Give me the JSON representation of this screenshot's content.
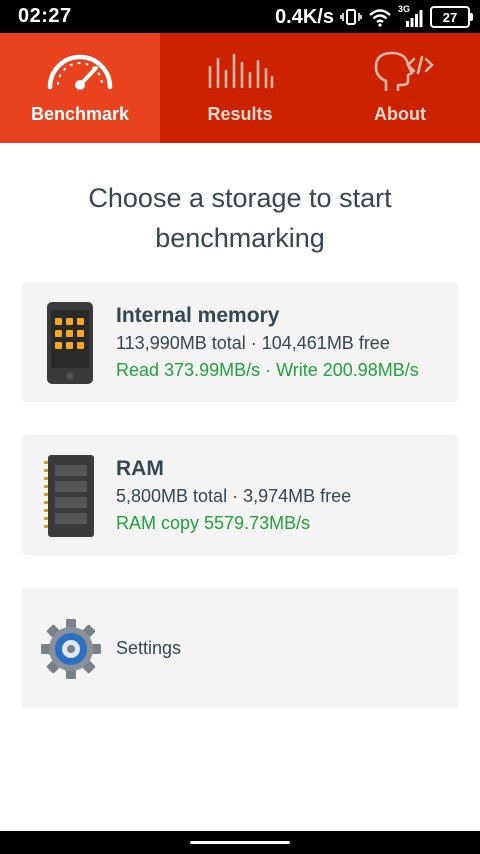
{
  "status_bar": {
    "time": "02:27",
    "net_speed": "0.4K/s",
    "network_type": "3G",
    "battery": "27",
    "icons": [
      "vibrate-icon",
      "wifi-icon",
      "signal-icon",
      "battery-icon"
    ]
  },
  "tabs": [
    {
      "label": "Benchmark",
      "icon": "speedometer-icon",
      "active": true
    },
    {
      "label": "Results",
      "icon": "bars-icon",
      "active": false
    },
    {
      "label": "About",
      "icon": "head-code-icon",
      "active": false
    }
  ],
  "heading": {
    "line1": "Choose a storage to start",
    "line2": "benchmarking"
  },
  "cards": {
    "internal": {
      "title": "Internal memory",
      "line1": "113,990MB total · 104,461MB free",
      "line2": "Read 373.99MB/s · Write 200.98MB/s",
      "icon": "phone-icon"
    },
    "ram": {
      "title": "RAM",
      "line1": "5,800MB total · 3,974MB free",
      "line2": "RAM copy 5579.73MB/s",
      "icon": "ram-chip-icon"
    },
    "settings": {
      "label": "Settings",
      "icon": "gear-icon"
    }
  },
  "colors": {
    "tab_bar": "#cc2200",
    "tab_active": "#e8421e",
    "text_dark": "#37474f",
    "text_green": "#22a33a",
    "card_bg": "#f4f4f4"
  }
}
